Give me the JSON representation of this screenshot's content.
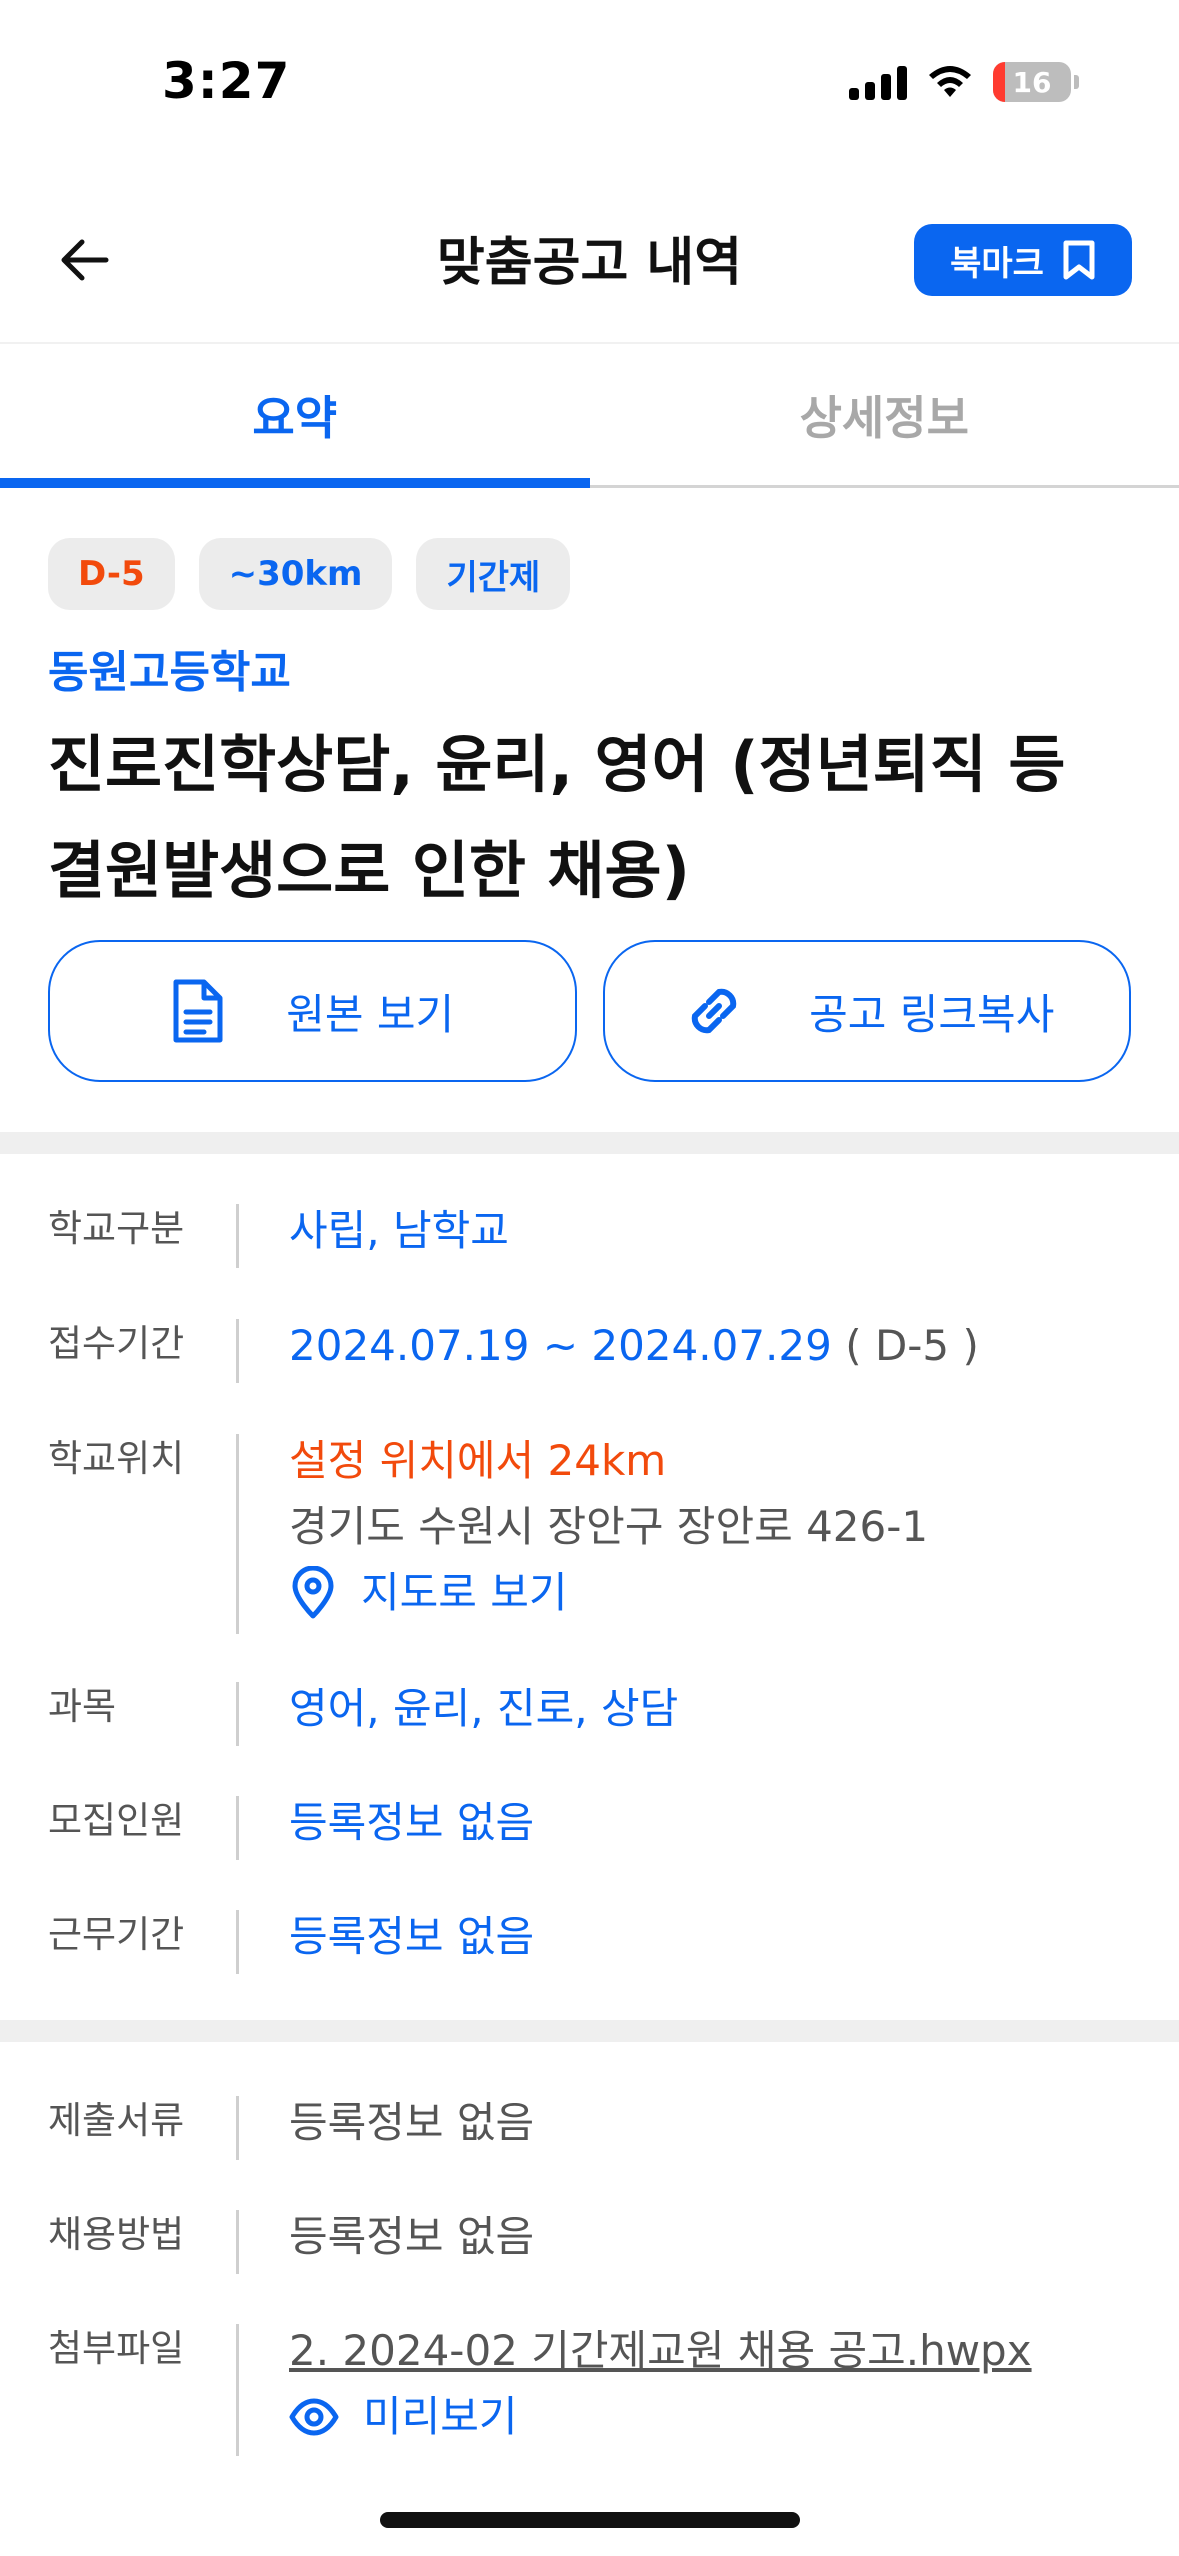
{
  "status_bar": {
    "time": "3:27",
    "battery": "16"
  },
  "header": {
    "title": "맞춤공고 내역",
    "bookmark_label": "북마크"
  },
  "tabs": [
    {
      "label": "요약",
      "active": true
    },
    {
      "label": "상세정보",
      "active": false
    }
  ],
  "summary": {
    "chips": [
      "D-5",
      "~30km",
      "기간제"
    ],
    "school": "동원고등학교",
    "title": "진로진학상담, 윤리, 영어 (정년퇴직 등 결원발생으로 인한 채용)",
    "view_original": "원본 보기",
    "copy_link": "공고 링크복사"
  },
  "info": {
    "school_type": {
      "label": "학교구분",
      "value": "사립, 남학교"
    },
    "period": {
      "label": "접수기간",
      "value": "2024.07.19 ~ 2024.07.29",
      "dday": "( D-5 )"
    },
    "location": {
      "label": "학교위치",
      "distance": "설정 위치에서 24km",
      "address": "경기도 수원시 장안구 장안로 426-1",
      "map_link": "지도로 보기"
    },
    "subject": {
      "label": "과목",
      "value": "영어, 윤리, 진로, 상담"
    },
    "recruit_count": {
      "label": "모집인원",
      "value": "등록정보 없음"
    },
    "work_period": {
      "label": "근무기간",
      "value": "등록정보 없음"
    }
  },
  "extra": {
    "documents": {
      "label": "제출서류",
      "value": "등록정보 없음"
    },
    "method": {
      "label": "채용방법",
      "value": "등록정보 없음"
    },
    "attachment": {
      "label": "첨부파일",
      "file": "2. 2024-02 기간제교원 채용 공고.hwpx",
      "preview": "미리보기"
    }
  },
  "colors": {
    "accent": "#0a66f0",
    "danger": "#f24a0c",
    "divider": "#efefef"
  },
  "icons": [
    "back-arrow-icon",
    "bookmark-icon",
    "document-icon",
    "link-icon",
    "map-pin-icon",
    "eye-icon",
    "signal-icon",
    "wifi-icon",
    "battery-icon"
  ]
}
